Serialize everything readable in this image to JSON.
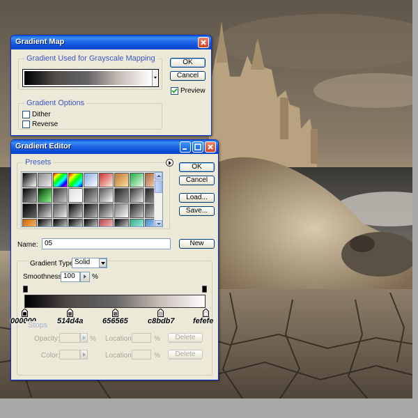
{
  "gradient_map": {
    "title": "Gradient Map",
    "group_mapping_title": "Gradient Used for Grayscale Mapping",
    "ok_label": "OK",
    "cancel_label": "Cancel",
    "preview_label": "Preview",
    "preview_checked": true,
    "group_options_title": "Gradient Options",
    "dither_label": "Dither",
    "dither_checked": false,
    "reverse_label": "Reverse",
    "reverse_checked": false
  },
  "gradient_editor": {
    "title": "Gradient Editor",
    "presets_title": "Presets",
    "ok_label": "OK",
    "cancel_label": "Cancel",
    "load_label": "Load...",
    "save_label": "Save...",
    "name_label": "Name:",
    "name_value": "05",
    "new_label": "New",
    "gradient_type_label": "Gradient Type:",
    "gradient_type_value": "Solid",
    "smoothness_label": "Smoothness:",
    "smoothness_value": "100",
    "smoothness_unit": "%",
    "stops_title": "Stops",
    "opacity_label": "Opacity:",
    "opacity_unit": "%",
    "location_label": "Location:",
    "location_unit": "%",
    "delete_label": "Delete",
    "color_label": "Color:",
    "color_stops": [
      {
        "label": "000000",
        "color": "#000000",
        "location": 0
      },
      {
        "label": "514d4a",
        "color": "#514d4a",
        "location": 25
      },
      {
        "label": "656565",
        "color": "#656565",
        "location": 50
      },
      {
        "label": "c8bdb7",
        "color": "#c8bdb7",
        "location": 75
      },
      {
        "label": "fefefe",
        "color": "#fefefe",
        "location": 100
      }
    ]
  },
  "colors": {
    "titlebar": "#0b4ed5",
    "window_bg": "#ece9d8",
    "group_title": "#3a57c8"
  }
}
